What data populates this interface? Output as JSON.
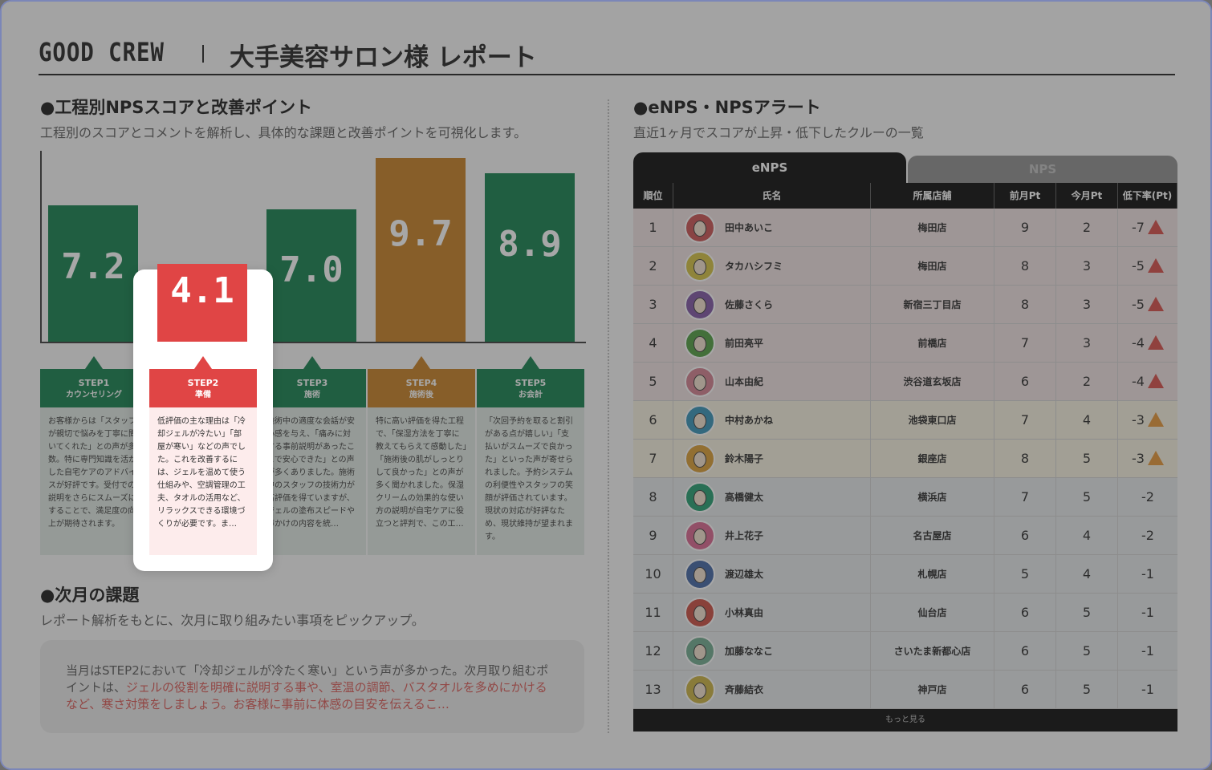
{
  "header": {
    "brand": "GOOD CREW",
    "title": "大手美容サロン様 レポート"
  },
  "left": {
    "section_title": "●工程別NPSスコアと改善ポイント",
    "section_desc": "工程別のスコアとコメントを解析し、具体的な課題と改善ポイントを可視化します。",
    "chart_data": {
      "type": "bar",
      "categories": [
        "STEP1",
        "STEP2",
        "STEP3",
        "STEP4",
        "STEP5"
      ],
      "values": [
        7.2,
        4.1,
        7.0,
        9.7,
        8.9
      ],
      "ylim": [
        0,
        10
      ],
      "colors": [
        "#0a7a45",
        "#e04545",
        "#0a7a45",
        "#c57a1a",
        "#0a7a45"
      ]
    },
    "bar_labels": [
      "7.2",
      "4.1",
      "7.0",
      "9.7",
      "8.9"
    ],
    "steps": [
      {
        "step": "STEP1",
        "name": "カウンセリング",
        "text": "お客様からは「スタッフが親切で悩みを丁寧に聞いてくれた」との声が多数。特に専門知識を活かした自宅ケアのアドバイスが好評です。受付での説明をさらにスムーズにすることで、満足度の向上が期待されます。",
        "color": "#0a7a45"
      },
      {
        "step": "STEP2",
        "name": "準備",
        "text": "低評価の主な理由は「冷却ジェルが冷たい」「部屋が寒い」などの声でした。これを改善するには、ジェルを温めて使う仕組みや、空調管理の工夫、タオルの活用など、リラックスできる環境づくりが必要です。ま…",
        "color": "#e04545"
      },
      {
        "step": "STEP3",
        "name": "施術",
        "text": "施術中の適度な会話が安心感を与え、「痛みに対する事前説明があったことで安心できた」との声が多くありました。施術中のスタッフの技術力が高評価を得ていますが、ジェルの塗布スピードや声かけの内容を統…",
        "color": "#0a7a45"
      },
      {
        "step": "STEP4",
        "name": "施術後",
        "text": "特に高い評価を得た工程で、「保湿方法を丁寧に教えてもらえて感動した」「施術後の肌がしっとりして良かった」との声が多く聞かれました。保湿クリームの効果的な使い方の説明が自宅ケアに役立つと評判で、この工…",
        "color": "#c57a1a"
      },
      {
        "step": "STEP5",
        "name": "お会計",
        "text": "「次回予約を取ると割引がある点が嬉しい」「支払いがスムーズで良かった」といった声が寄せられました。予約システムの利便性やスタッフの笑顔が評価されています。現状の対応が好評なため、現状維持が望まれます。",
        "color": "#0a7a45"
      }
    ],
    "next": {
      "title": "●次月の課題",
      "desc": "レポート解析をもとに、次月に取り組みたい事項をピックアップ。",
      "text_plain": "当月はSTEP2において「冷却ジェルが冷たく寒い」という声が多かった。次月取り組むポイントは、",
      "text_highlight": "ジェルの役割を明確に説明する事や、室温の調節、バスタオルを多めにかけるなど、寒さ対策をしましょう。お客様に事前に体感の目安を伝えるこ…"
    }
  },
  "right": {
    "section_title": "●eNPS・NPSアラート",
    "section_desc": "直近1ヶ月でスコアが上昇・低下したクルーの一覧",
    "tabs": [
      "eNPS",
      "NPS"
    ],
    "columns": [
      "順位",
      "氏名",
      "所属店舗",
      "前月Pt",
      "今月Pt",
      "低下率(Pt)"
    ],
    "rows": [
      {
        "rank": "1",
        "name": "田中あいこ",
        "store": "梅田店",
        "prev": "9",
        "cur": "2",
        "drop": "-7",
        "level": "red",
        "bg": "#efe0e0",
        "av": "#c94b4b"
      },
      {
        "rank": "2",
        "name": "タカハシフミ",
        "store": "梅田店",
        "prev": "8",
        "cur": "3",
        "drop": "-5",
        "level": "red",
        "bg": "#efe0e0",
        "av": "#d4c03a"
      },
      {
        "rank": "3",
        "name": "佐藤さくら",
        "store": "新宿三丁目店",
        "prev": "8",
        "cur": "3",
        "drop": "-5",
        "level": "red",
        "bg": "#efe0e0",
        "av": "#7a4fa0"
      },
      {
        "rank": "4",
        "name": "前田亮平",
        "store": "前橋店",
        "prev": "7",
        "cur": "3",
        "drop": "-4",
        "level": "red",
        "bg": "#efe0e0",
        "av": "#4a9a3a"
      },
      {
        "rank": "5",
        "name": "山本由紀",
        "store": "渋谷道玄坂店",
        "prev": "6",
        "cur": "2",
        "drop": "-4",
        "level": "red",
        "bg": "#efe0e0",
        "av": "#d27a8a"
      },
      {
        "rank": "6",
        "name": "中村あかね",
        "store": "池袋東口店",
        "prev": "7",
        "cur": "4",
        "drop": "-3",
        "level": "orange",
        "bg": "#f6f0df",
        "av": "#2e8fb5"
      },
      {
        "rank": "7",
        "name": "鈴木陽子",
        "store": "銀座店",
        "prev": "8",
        "cur": "5",
        "drop": "-3",
        "level": "orange",
        "bg": "#f6f0df",
        "av": "#d99a2a"
      },
      {
        "rank": "8",
        "name": "高橋健太",
        "store": "横浜店",
        "prev": "7",
        "cur": "5",
        "drop": "-2",
        "level": "none",
        "bg": "#e4e8ea",
        "av": "#1a9a6a"
      },
      {
        "rank": "9",
        "name": "井上花子",
        "store": "名古屋店",
        "prev": "6",
        "cur": "4",
        "drop": "-2",
        "level": "none",
        "bg": "#e4e8ea",
        "av": "#d95f8a"
      },
      {
        "rank": "10",
        "name": "渡辺雄太",
        "store": "札幌店",
        "prev": "5",
        "cur": "4",
        "drop": "-1",
        "level": "none",
        "bg": "#e4e8ea",
        "av": "#3a5fa0"
      },
      {
        "rank": "11",
        "name": "小林真由",
        "store": "仙台店",
        "prev": "6",
        "cur": "5",
        "drop": "-1",
        "level": "none",
        "bg": "#e4e8ea",
        "av": "#c9453a"
      },
      {
        "rank": "12",
        "name": "加藤ななこ",
        "store": "さいたま新都心店",
        "prev": "6",
        "cur": "5",
        "drop": "-1",
        "level": "none",
        "bg": "#e4e8ea",
        "av": "#6aa88a"
      },
      {
        "rank": "13",
        "name": "斉藤結衣",
        "store": "神戸店",
        "prev": "6",
        "cur": "5",
        "drop": "-1",
        "level": "none",
        "bg": "#e4e8ea",
        "av": "#c9b03a"
      }
    ],
    "more": "もっと見る"
  }
}
